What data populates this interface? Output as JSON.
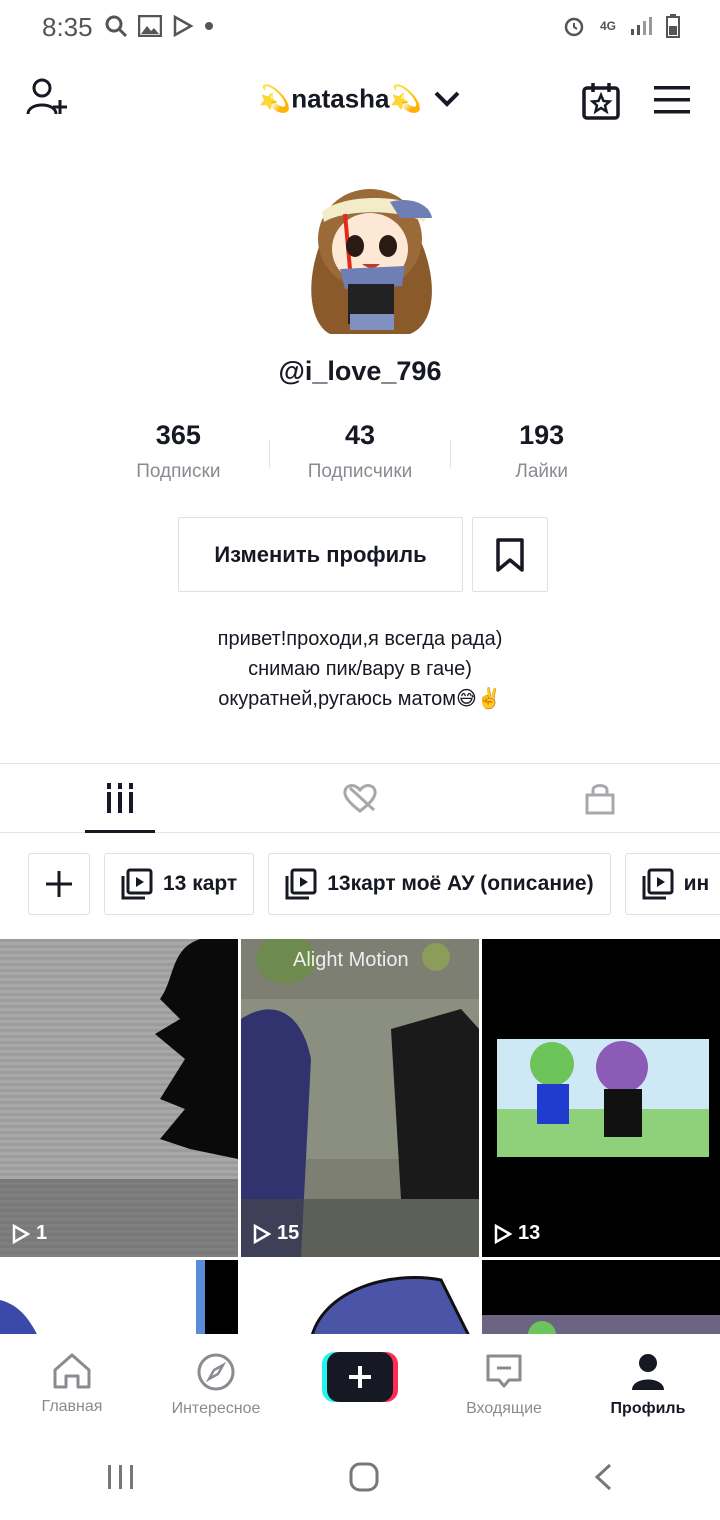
{
  "status_bar": {
    "time": "8:35",
    "network": "4G"
  },
  "header": {
    "username": "natasha",
    "username_emoji_left": "💫",
    "username_emoji_right": "💫"
  },
  "profile": {
    "handle": "@i_love_796",
    "stats": [
      {
        "value": "365",
        "label": "Подписки"
      },
      {
        "value": "43",
        "label": "Подписчики"
      },
      {
        "value": "193",
        "label": "Лайки"
      }
    ],
    "edit_button": "Изменить профиль",
    "bio_lines": [
      "привет!проходи,я всегда рада)",
      "снимаю пик/вару в гаче)",
      "окуратней,ругаюсь матом😅✌️"
    ]
  },
  "playlists": [
    {
      "label": "13 карт"
    },
    {
      "label": "13карт моё АУ (описание)"
    },
    {
      "label": "ин"
    }
  ],
  "videos": [
    {
      "views": "1"
    },
    {
      "views": "15",
      "watermark": "Alight Motion"
    },
    {
      "views": "13"
    }
  ],
  "bottom_nav": [
    {
      "label": "Главная",
      "icon": "home-icon"
    },
    {
      "label": "Интересное",
      "icon": "compass-icon"
    },
    {
      "label": "",
      "icon": "plus-icon"
    },
    {
      "label": "Входящие",
      "icon": "inbox-icon"
    },
    {
      "label": "Профиль",
      "icon": "profile-icon"
    }
  ],
  "colors": {
    "accent_cyan": "#25f4ee",
    "accent_red": "#fe2c55",
    "text": "#161823",
    "muted": "#8a8b91"
  }
}
